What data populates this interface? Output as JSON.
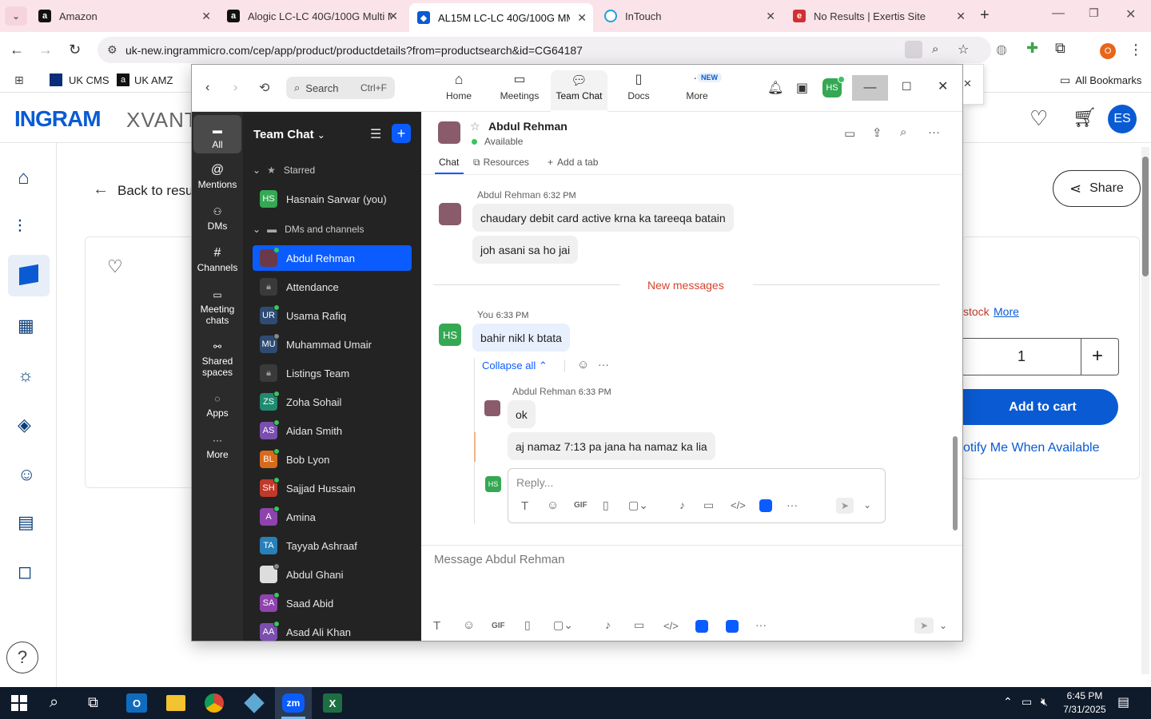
{
  "browser": {
    "tabs": [
      {
        "title": "Amazon",
        "icon": "amazon-favicon",
        "color": "#111"
      },
      {
        "title": "Alogic LC-LC 40G/100G Multi M",
        "icon": "amazon-favicon",
        "color": "#111"
      },
      {
        "title": "AL15M LC-LC 40G/100G MMD",
        "icon": "ingram-favicon",
        "color": "#0a5bd3"
      },
      {
        "title": "InTouch",
        "icon": "intouch-favicon",
        "color": "#1aa5d8"
      },
      {
        "title": "No Results | Exertis Site",
        "icon": "exertis-favicon",
        "color": "#d32f2f"
      }
    ],
    "url": "uk-new.ingrammicro.com/cep/app/product/productdetails?from=productsearch&id=CG64187",
    "profile_initial": "O",
    "bookmarks": [
      "UK CMS",
      "UK AMZ"
    ],
    "all_bookmarks": "All Bookmarks"
  },
  "ingram": {
    "logo": "INGRAM",
    "logo_suffix": "XVANT",
    "user_initials": "ES",
    "back_label": "Back to resu",
    "share_label": "Share",
    "stock_text": "stock",
    "more_link": "More",
    "quantity": "1",
    "add_to_cart": "Add to cart",
    "notify": "otify Me When Available"
  },
  "zoom": {
    "search_placeholder": "Search",
    "search_shortcut": "Ctrl+F",
    "nav": [
      {
        "label": "Home"
      },
      {
        "label": "Meetings"
      },
      {
        "label": "Team Chat"
      },
      {
        "label": "Docs"
      },
      {
        "label": "More",
        "badge": "NEW"
      }
    ],
    "user_initials": "HS",
    "rail": [
      {
        "label": "All",
        "icon": "chat-bubble-icon"
      },
      {
        "label": "Mentions",
        "icon": "at-icon"
      },
      {
        "label": "DMs",
        "icon": "people-icon"
      },
      {
        "label": "Channels",
        "icon": "hash-icon"
      },
      {
        "label": "Meeting chats",
        "icon": "calendar-icon"
      },
      {
        "label": "Shared spaces",
        "icon": "share-nodes-icon"
      },
      {
        "label": "Apps",
        "icon": "apps-icon"
      },
      {
        "label": "More",
        "icon": "more-icon"
      }
    ],
    "list_title": "Team Chat",
    "sections": {
      "starred": "Starred",
      "dms": "DMs and channels"
    },
    "starred": [
      {
        "name": "Hasnain Sarwar (you)",
        "initials": "HS",
        "color": "#35a853"
      }
    ],
    "contacts": [
      {
        "name": "Abdul Rehman",
        "initials": "",
        "color": "#6b3a4a",
        "status": "online",
        "photo": true
      },
      {
        "name": "Attendance",
        "initials": "",
        "color": "#3a3a3a",
        "status": "lock"
      },
      {
        "name": "Usama Rafiq",
        "initials": "UR",
        "color": "#2e4c73",
        "status": "online"
      },
      {
        "name": "Muhammad Umair",
        "initials": "MU",
        "color": "#2e4c73",
        "status": "away"
      },
      {
        "name": "Listings Team",
        "initials": "",
        "color": "#3a3a3a",
        "status": "lock"
      },
      {
        "name": "Zoha Sohail",
        "initials": "ZS",
        "color": "#1f8a70",
        "status": "online"
      },
      {
        "name": "Aidan Smith",
        "initials": "AS",
        "color": "#7b4fb0",
        "status": "online"
      },
      {
        "name": "Bob Lyon",
        "initials": "BL",
        "color": "#d86a1c",
        "status": "online"
      },
      {
        "name": "Sajjad Hussain",
        "initials": "SH",
        "color": "#c0392b",
        "status": "online"
      },
      {
        "name": "Amina",
        "initials": "A",
        "color": "#8e44ad",
        "status": "online"
      },
      {
        "name": "Tayyab Ashraaf",
        "initials": "TA",
        "color": "#2980b9",
        "status": "none"
      },
      {
        "name": "Abdul Ghani",
        "initials": "",
        "color": "#ddd",
        "status": "away",
        "photo": true
      },
      {
        "name": "Saad Abid",
        "initials": "SA",
        "color": "#8e44ad",
        "status": "online"
      },
      {
        "name": "Asad Ali Khan",
        "initials": "AA",
        "color": "#7b4fb0",
        "status": "online"
      }
    ],
    "chat": {
      "contact_name": "Abdul Rehman",
      "contact_status": "Available",
      "tabs": [
        "Chat",
        "Resources",
        "Add a tab"
      ],
      "messages": [
        {
          "sender": "Abdul Rehman",
          "time": "6:32 PM",
          "lines": [
            "chaudary  debit card active krna ka tareeqa batain",
            "joh asani sa ho jai"
          ]
        },
        {
          "divider": "New messages"
        },
        {
          "sender": "You",
          "time": "6:33 PM",
          "lines": [
            "bahir nikl k btata"
          ]
        },
        {
          "sender": "Abdul Rehman",
          "time": "6:33 PM",
          "lines": [
            "ok",
            "aj namaz 7:13 pa jana ha namaz   ka lia"
          ]
        }
      ],
      "collapse_label": "Collapse all",
      "reply_placeholder": "Reply...",
      "message_placeholder": "Message Abdul Rehman"
    }
  },
  "taskbar": {
    "time": "6:45 PM",
    "date": "7/31/2025"
  }
}
